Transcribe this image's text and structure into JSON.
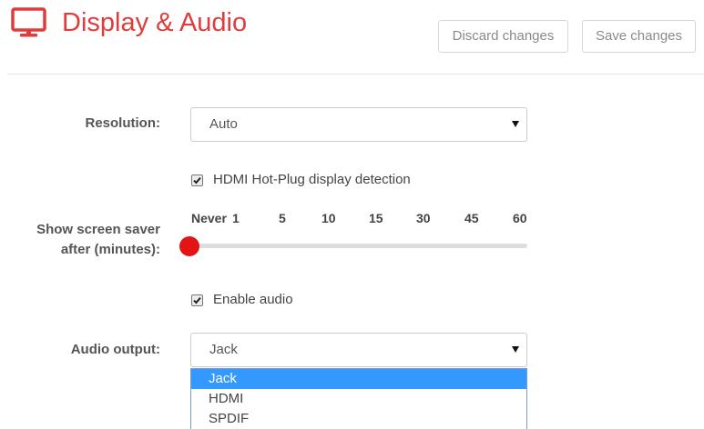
{
  "header": {
    "title": "Display & Audio",
    "icon": "monitor-icon",
    "accent_color": "#e03c3c",
    "discard_label": "Discard changes",
    "save_label": "Save changes"
  },
  "resolution": {
    "label": "Resolution:",
    "value": "Auto"
  },
  "hdmi_hotplug": {
    "label": "HDMI Hot-Plug display detection",
    "checked": true
  },
  "screen_saver": {
    "label": "Show screen saver after (minutes):",
    "ticks": [
      "Never",
      "1",
      "5",
      "10",
      "15",
      "30",
      "45",
      "60"
    ],
    "selected": "Never",
    "thumb_color": "#e31414"
  },
  "enable_audio": {
    "label": "Enable audio",
    "checked": true
  },
  "audio_output": {
    "label": "Audio output:",
    "value": "Jack",
    "dropdown_open": true,
    "options": [
      "Jack",
      "HDMI",
      "SPDIF"
    ],
    "highlighted_option": "Jack",
    "highlight_color": "#3399ff"
  }
}
